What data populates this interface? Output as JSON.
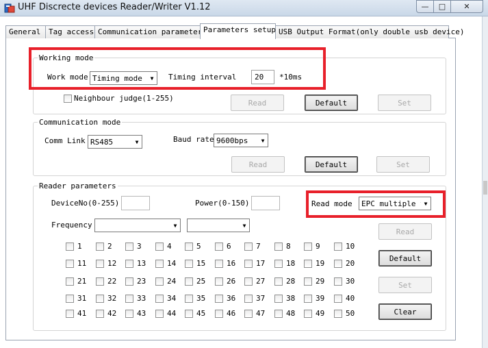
{
  "window": {
    "title": "UHF Discrecte devices Reader/Writer V1.12",
    "minimize_glyph": "—",
    "maximize_glyph": "□",
    "close_glyph": "✕"
  },
  "tabs": [
    {
      "label": "General",
      "active": false
    },
    {
      "label": "Tag access",
      "active": false
    },
    {
      "label": "Communication parameters",
      "active": false
    },
    {
      "label": "Parameters setup",
      "active": true
    },
    {
      "label": "USB Output Format(only double usb device)",
      "active": false
    }
  ],
  "working_mode": {
    "title": "Working mode",
    "work_mode_label": "Work mode",
    "work_mode_value": "Timing mode",
    "timing_interval_label": "Timing interval",
    "timing_interval_value": "20",
    "unit": "*10ms",
    "neighbour_judge_label": "Neighbour judge(1-255)",
    "buttons": {
      "read": "Read",
      "default": "Default",
      "set": "Set"
    }
  },
  "communication_mode": {
    "title": "Communication mode",
    "comm_link_label": "Comm Link",
    "comm_link_value": "RS485",
    "baud_rate_label": "Baud rate",
    "baud_rate_value": "9600bps",
    "buttons": {
      "read": "Read",
      "default": "Default",
      "set": "Set"
    }
  },
  "reader_parameters": {
    "title": "Reader parameters",
    "device_no_label": "DeviceNo(0-255)",
    "device_no_value": "",
    "power_label": "Power(0-150)",
    "power_value": "",
    "read_mode_label": "Read mode",
    "read_mode_value": "EPC multiple t",
    "frequency_label": "Frequency",
    "frequency_from": "",
    "frequency_to": "",
    "channels": [
      "1",
      "2",
      "3",
      "4",
      "5",
      "6",
      "7",
      "8",
      "9",
      "10",
      "11",
      "12",
      "13",
      "14",
      "15",
      "16",
      "17",
      "18",
      "19",
      "20",
      "21",
      "22",
      "23",
      "24",
      "25",
      "26",
      "27",
      "28",
      "29",
      "30",
      "31",
      "32",
      "33",
      "34",
      "35",
      "36",
      "37",
      "38",
      "39",
      "40",
      "41",
      "42",
      "43",
      "44",
      "45",
      "46",
      "47",
      "48",
      "49",
      "50"
    ],
    "buttons": {
      "read": "Read",
      "default": "Default",
      "set": "Set",
      "clear": "Clear"
    }
  },
  "highlight_color": "#e8202a"
}
